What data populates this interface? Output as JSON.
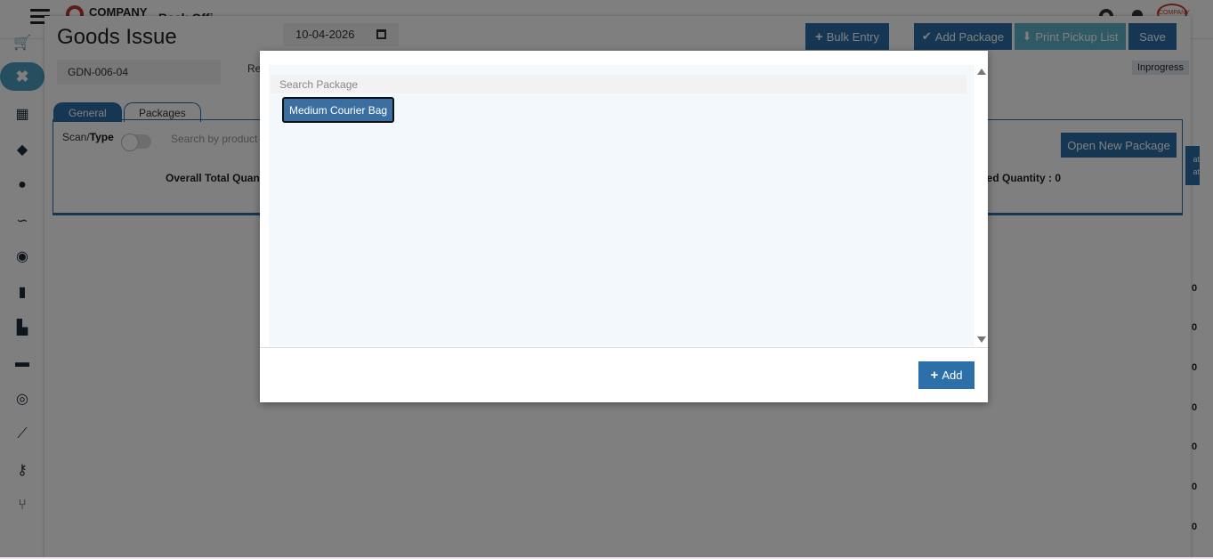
{
  "header": {
    "logo_text": "COMPANY",
    "back_office": "Back Offi",
    "brand_logo_text": "COMPANY"
  },
  "page": {
    "title": "Goods Issue",
    "date": "10-04-2026",
    "document_no": "GDN-006-04",
    "re_label": "Re",
    "status": "Inprogress"
  },
  "toolbar": {
    "bulk_entry": "Bulk Entry",
    "add_package": "Add Package",
    "print_pickup_list": "Print Pickup List",
    "save": "Save"
  },
  "tabs": [
    {
      "label": "General"
    },
    {
      "label": "Packages"
    }
  ],
  "general": {
    "scan_label": "Scan/",
    "type_label": "Type",
    "search_placeholder": "Search by product",
    "open_new_package": "Open New Package",
    "overall_total_qty": "Overall Total Quan",
    "completed_qty": "eted Quantity : 0"
  },
  "side_values": [
    "0",
    "0",
    "0",
    "0",
    "0",
    "0",
    "0"
  ],
  "side_button_text": "at at",
  "sidebar_icons": [
    "cart-icon",
    "close-icon",
    "boxes-icon",
    "tags-icon",
    "user-icon",
    "route-icon",
    "chat-icon",
    "book-icon",
    "chart-bar-icon",
    "briefcase-icon",
    "globe-icon",
    "line-chart-icon",
    "key-icon",
    "flow-icon"
  ],
  "modal": {
    "search_placeholder": "Search Package",
    "packages": [
      {
        "label": "Medium Courier Bag",
        "selected": true
      }
    ],
    "add_button": "Add"
  },
  "colors": {
    "primary": "#2d6fa8",
    "teal": "#5fb3c8",
    "selected_item": "#3b6fa2"
  }
}
